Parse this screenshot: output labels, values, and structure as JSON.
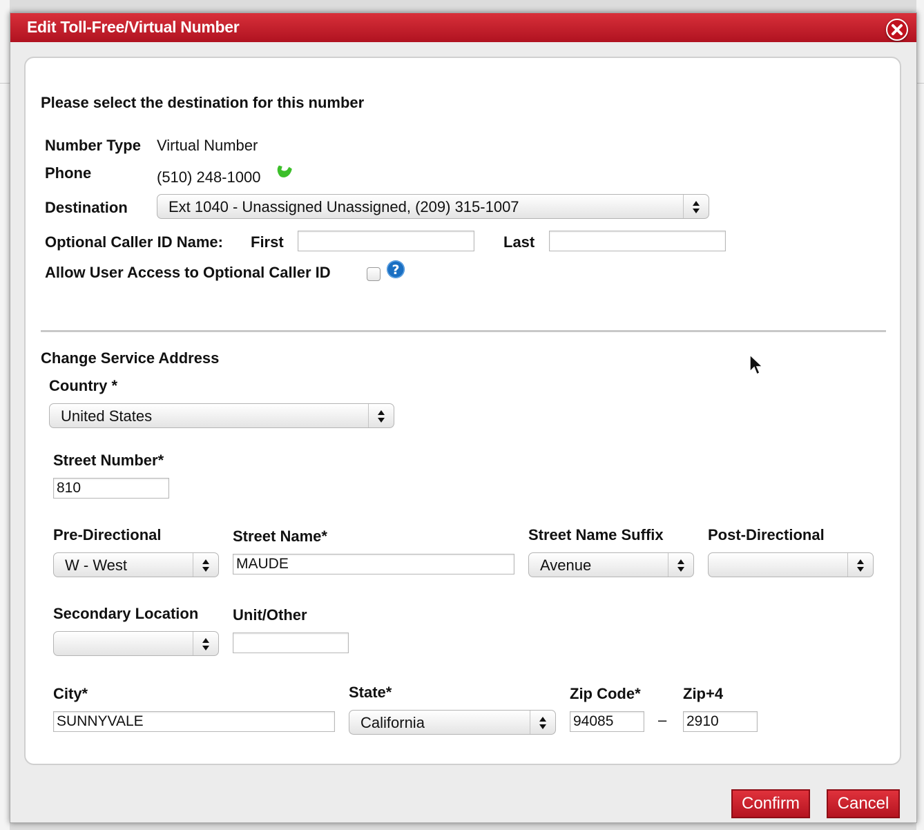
{
  "dialog": {
    "title": "Edit Toll-Free/Virtual Number",
    "heading": "Please select the destination for this number"
  },
  "number": {
    "type_label": "Number Type",
    "type_value": "Virtual Number",
    "phone_label": "Phone",
    "phone_value": "(510) 248-1000",
    "destination_label": "Destination",
    "destination_value": "Ext 1040 - Unassigned Unassigned, (209) 315-1007",
    "caller_id_label": "Optional Caller ID Name:",
    "first_label": "First",
    "first_value": "",
    "last_label": "Last",
    "last_value": "",
    "allow_access_label": "Allow User Access to Optional Caller ID",
    "allow_access_checked": false
  },
  "address": {
    "section_title": "Change Service Address",
    "country_label": "Country *",
    "country_value": "United States",
    "street_number_label": "Street Number*",
    "street_number_value": "810",
    "pre_directional_label": "Pre-Directional",
    "pre_directional_value": "W - West",
    "street_name_label": "Street Name*",
    "street_name_value": "MAUDE",
    "street_suffix_label": "Street Name Suffix",
    "street_suffix_value": "Avenue",
    "post_directional_label": "Post-Directional",
    "post_directional_value": "",
    "secondary_location_label": "Secondary Location",
    "secondary_location_value": "",
    "unit_label": "Unit/Other",
    "unit_value": "",
    "city_label": "City*",
    "city_value": "SUNNYVALE",
    "state_label": "State*",
    "state_value": "California",
    "zip_label": "Zip Code*",
    "zip_value": "94085",
    "zip_separator": "–",
    "zip4_label": "Zip+4",
    "zip4_value": "2910"
  },
  "buttons": {
    "confirm": "Confirm",
    "cancel": "Cancel"
  },
  "colors": {
    "brand_red": "#c8202c",
    "phone_icon_green": "#3cbf2a",
    "help_icon_blue": "#1a6fc2"
  },
  "icons": {
    "close": "close-icon",
    "phone": "phone-icon",
    "help": "help-icon"
  }
}
